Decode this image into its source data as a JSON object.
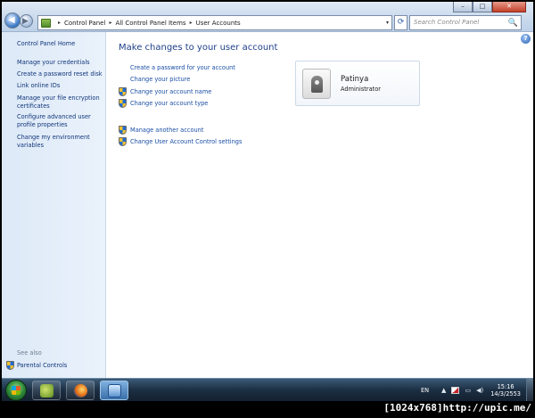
{
  "window": {
    "minimize_glyph": "–",
    "maximize_glyph": "□",
    "close_glyph": "✕",
    "back_glyph": "◀",
    "forward_glyph": "▶"
  },
  "address_bar": {
    "breadcrumbs": [
      "Control Panel",
      "All Control Panel Items",
      "User Accounts"
    ],
    "separator": "▸",
    "dropdown_glyph": "▾",
    "refresh_glyph": "⟳",
    "search_placeholder": "Search Control Panel",
    "search_icon": "🔍"
  },
  "sidebar": {
    "links": [
      {
        "label": "Control Panel Home"
      },
      {
        "label": "Manage your credentials"
      },
      {
        "label": "Create a password reset disk"
      },
      {
        "label": "Link online IDs"
      },
      {
        "label": "Manage your file encryption certificates"
      },
      {
        "label": "Configure advanced user profile properties"
      },
      {
        "label": "Change my environment variables"
      }
    ],
    "see_also_label": "See also",
    "parental_controls": "Parental Controls"
  },
  "main": {
    "help_glyph": "?",
    "heading": "Make changes to your user account",
    "tasks": [
      {
        "label": "Create a password for your account",
        "shield": false
      },
      {
        "label": "Change your picture",
        "shield": false
      },
      {
        "label": "Change your account name",
        "shield": true
      },
      {
        "label": "Change your account type",
        "shield": true
      },
      {
        "label": "Manage another account",
        "shield": true
      },
      {
        "label": "Change User Account Control settings",
        "shield": true
      }
    ],
    "account": {
      "name": "Patinya",
      "role": "Administrator"
    }
  },
  "taskbar": {
    "language": "EN",
    "tray_arrow": "▲",
    "time": "15:16",
    "date": "14/3/2553"
  },
  "watermark": "[1024x768]http://upic.me/"
}
